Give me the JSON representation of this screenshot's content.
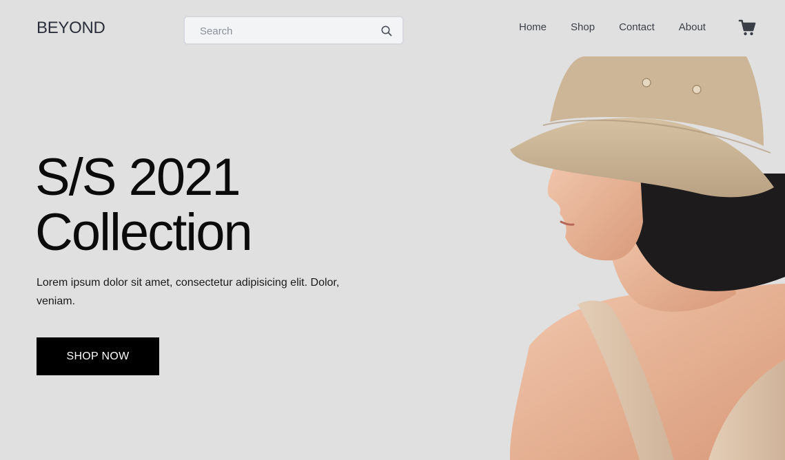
{
  "header": {
    "brand": "BEYOND",
    "search": {
      "placeholder": "Search",
      "value": ""
    },
    "nav": [
      {
        "label": "Home"
      },
      {
        "label": "Shop"
      },
      {
        "label": "Contact"
      },
      {
        "label": "About"
      }
    ],
    "icons": {
      "search": "search-icon",
      "cart": "cart-icon"
    }
  },
  "hero": {
    "title_line1": "S/S 2021",
    "title_line2": "Collection",
    "description": "Lorem ipsum dolor sit amet, consectetur adipisicing elit. Dolor, veniam.",
    "cta_label": "SHOP NOW"
  },
  "colors": {
    "background": "#e0e0e0",
    "primary_text": "#0b0b0b",
    "button_bg": "#000000",
    "button_text": "#ffffff"
  }
}
